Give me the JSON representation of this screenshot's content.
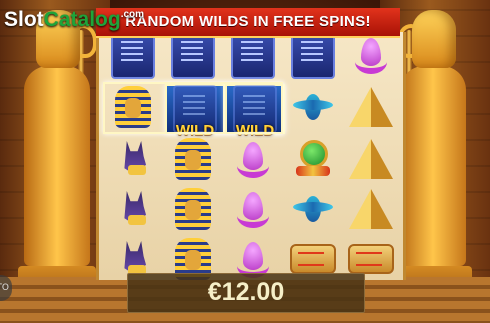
{
  "banner": {
    "text": "RANDOM WILDS IN FREE SPINS!"
  },
  "logo": {
    "slot": "Slot",
    "catalog": "Catalog",
    "dotcom": ".com"
  },
  "wild_label": "WILD",
  "win": {
    "amount": "€12.00"
  },
  "side_button": {
    "label": "TO"
  },
  "reels": {
    "columns": 5,
    "rows": [
      [
        "tablet",
        "tablet",
        "tablet",
        "tablet",
        "lotus"
      ],
      [
        "pharaoh",
        "wild",
        "wild",
        "scarab",
        "pyramid"
      ],
      [
        "anubis",
        "pharaoh",
        "lotus",
        "amulet",
        "pyramid"
      ],
      [
        "anubis",
        "pharaoh",
        "lotus",
        "scarab",
        "pyramid"
      ],
      [
        "anubis",
        "pharaoh",
        "lotus",
        "cartouche",
        "cartouche"
      ]
    ]
  },
  "colors": {
    "banner": "#c8200e",
    "wild_text": "#ffd23a",
    "win_text": "#f6efc8"
  }
}
